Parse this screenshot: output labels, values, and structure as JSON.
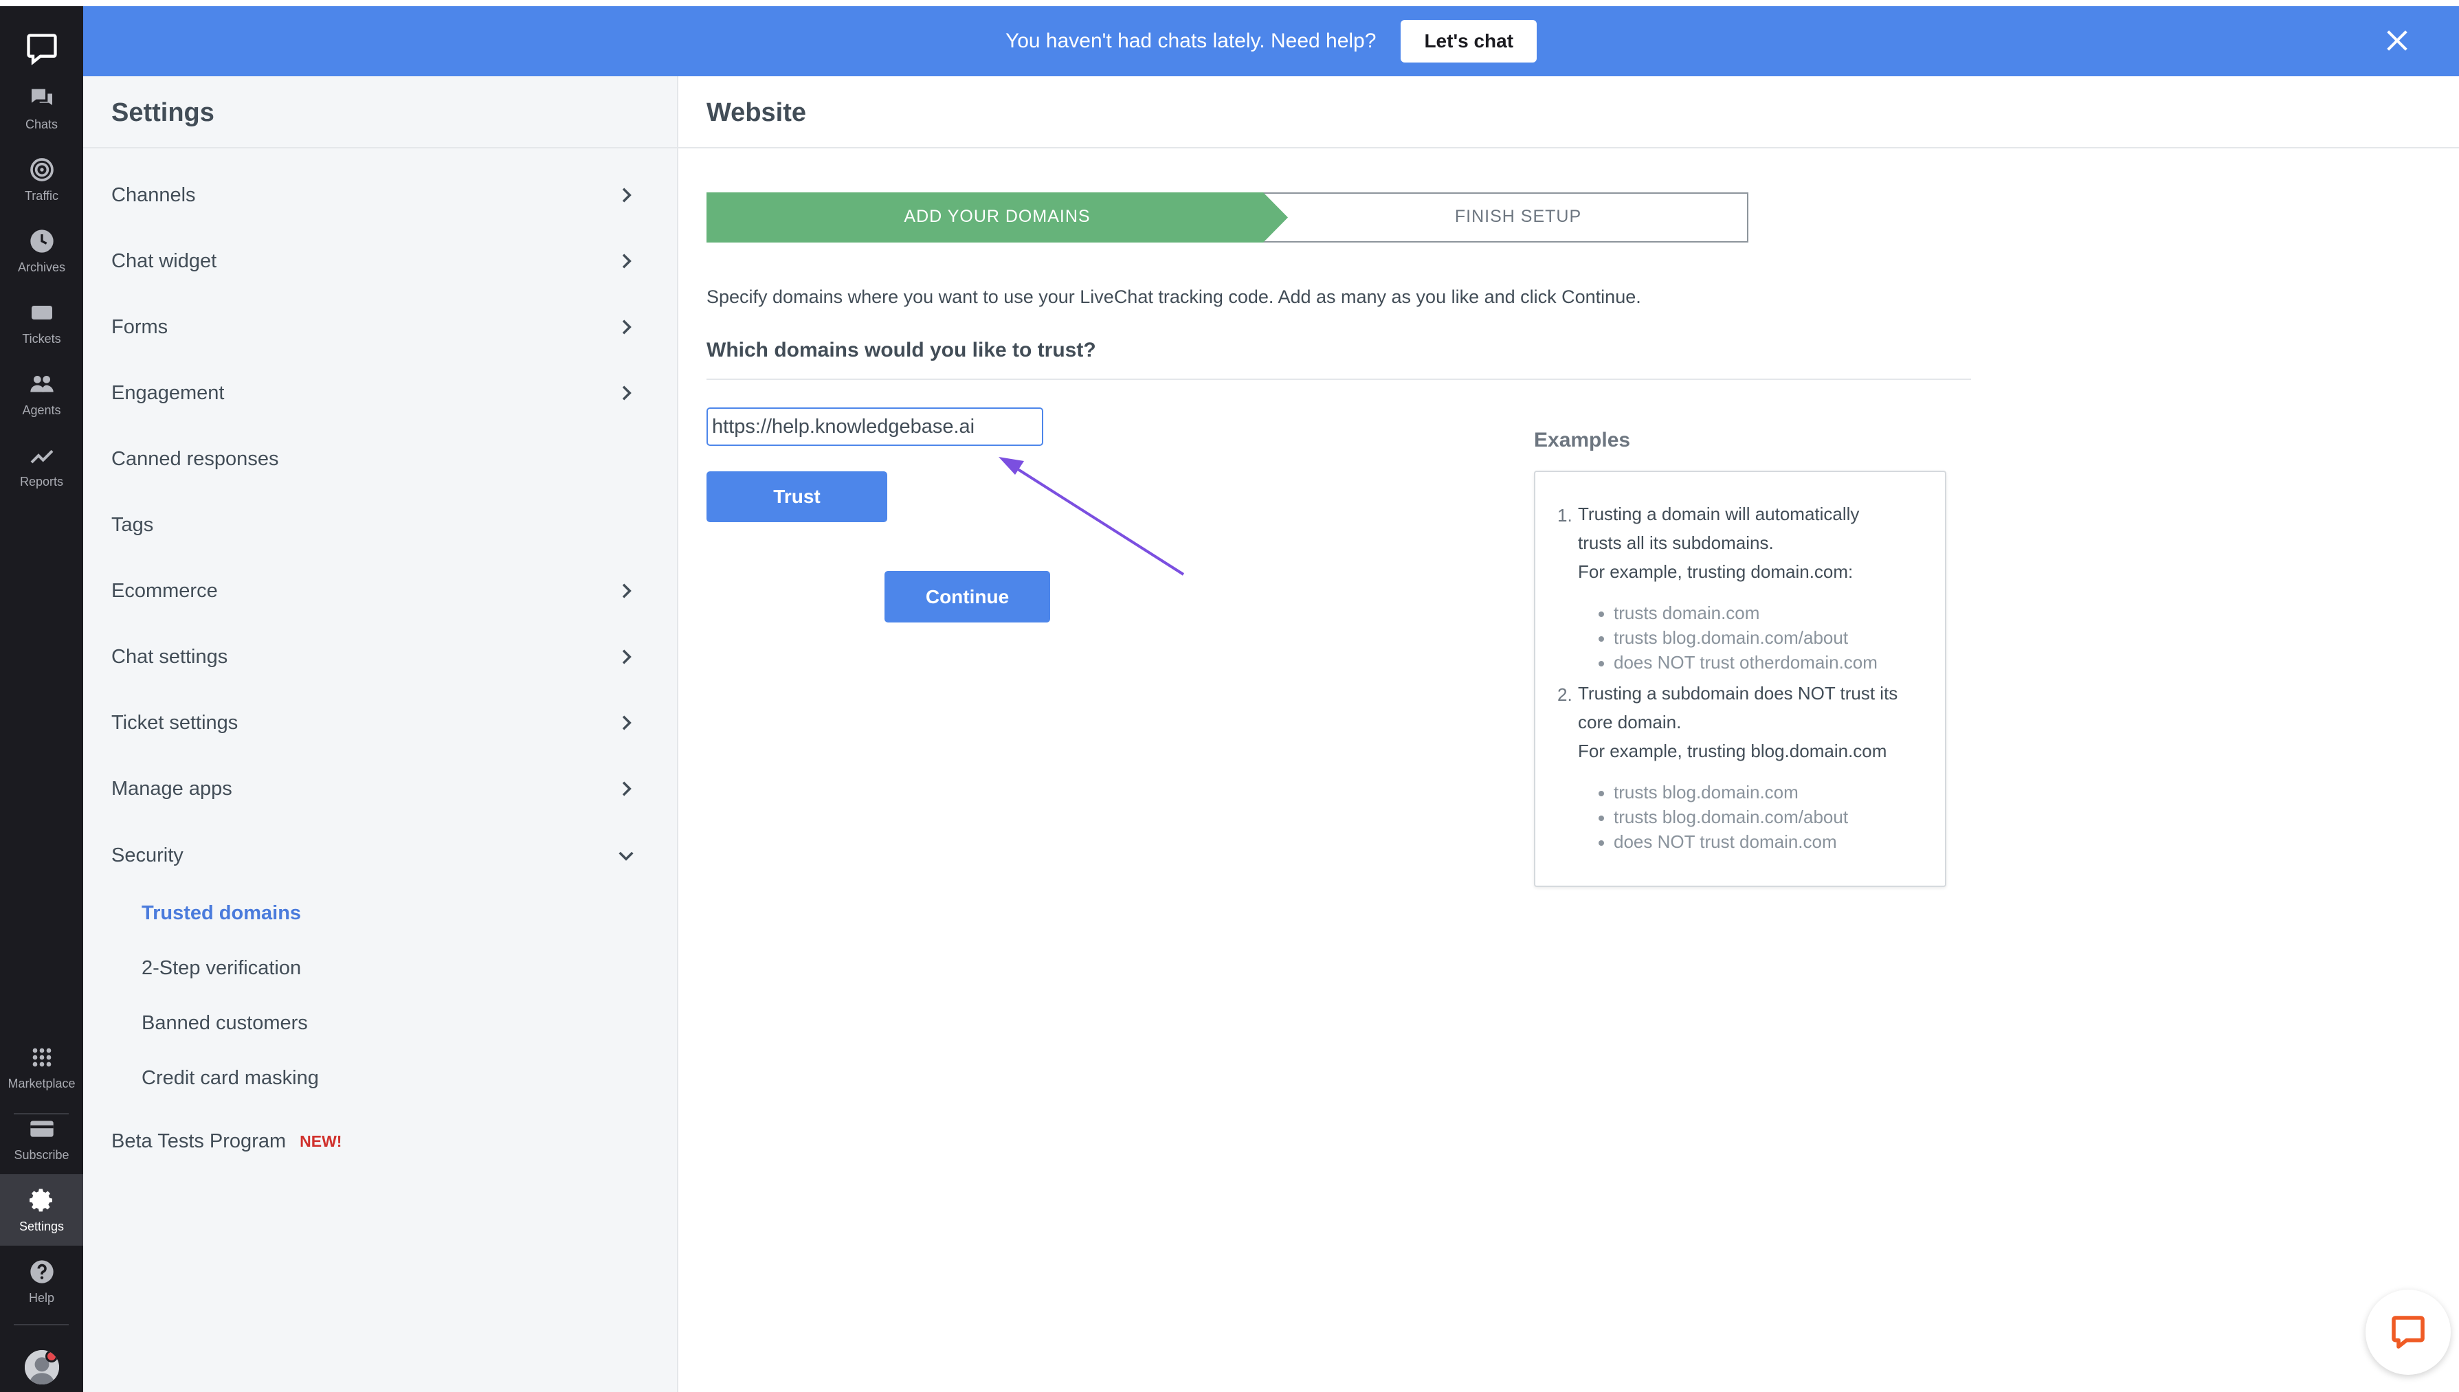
{
  "banner": {
    "text": "You haven't had chats lately. Need help?",
    "button_label": "Let's chat"
  },
  "rail": {
    "items": [
      {
        "label": "Chats",
        "icon": "chats-icon"
      },
      {
        "label": "Traffic",
        "icon": "traffic-icon"
      },
      {
        "label": "Archives",
        "icon": "archives-icon"
      },
      {
        "label": "Tickets",
        "icon": "tickets-icon"
      },
      {
        "label": "Agents",
        "icon": "agents-icon"
      },
      {
        "label": "Reports",
        "icon": "reports-icon"
      }
    ],
    "bottom_items": [
      {
        "label": "Marketplace",
        "icon": "marketplace-icon"
      },
      {
        "label": "Subscribe",
        "icon": "subscribe-icon"
      },
      {
        "label": "Settings",
        "icon": "settings-icon"
      },
      {
        "label": "Help",
        "icon": "help-icon"
      }
    ],
    "active": "Settings"
  },
  "settings": {
    "title": "Settings",
    "items": [
      {
        "label": "Channels"
      },
      {
        "label": "Chat widget"
      },
      {
        "label": "Forms"
      },
      {
        "label": "Engagement"
      },
      {
        "label": "Canned responses"
      },
      {
        "label": "Tags"
      },
      {
        "label": "Ecommerce"
      },
      {
        "label": "Chat settings"
      },
      {
        "label": "Ticket settings"
      },
      {
        "label": "Manage apps"
      },
      {
        "label": "Security"
      }
    ],
    "security_sub": [
      {
        "label": "Trusted domains"
      },
      {
        "label": "2-Step verification"
      },
      {
        "label": "Banned customers"
      },
      {
        "label": "Credit card masking"
      }
    ],
    "beta": {
      "label": "Beta Tests Program",
      "badge": "NEW!"
    }
  },
  "main": {
    "title": "Website",
    "steps": [
      {
        "label": "ADD YOUR DOMAINS",
        "state": "active"
      },
      {
        "label": "FINISH SETUP",
        "state": "pending"
      }
    ],
    "description": "Specify domains where you want to use your LiveChat tracking code. Add as many as you like and click Continue.",
    "question": "Which domains would you like to trust?",
    "domain_input_value": "https://help.knowledgebase.ai",
    "trust_label": "Trust",
    "continue_label": "Continue"
  },
  "examples": {
    "title": "Examples",
    "items": [
      {
        "number": "1.",
        "lines": [
          "Trusting a domain will automatically",
          "trusts all its subdomains."
        ],
        "example_intro": "For example, trusting domain.com:",
        "bullets": [
          "trusts domain.com",
          "trusts blog.domain.com/about",
          "does NOT trust otherdomain.com"
        ]
      },
      {
        "number": "2.",
        "lines": [
          "Trusting a subdomain does NOT trust its",
          "core domain."
        ],
        "example_intro": "For example, trusting blog.domain.com",
        "bullets": [
          "trusts blog.domain.com",
          "trusts blog.domain.com/about",
          "does NOT trust domain.com"
        ]
      }
    ]
  },
  "colors": {
    "banner": "#4d86ea",
    "rail": "#1b1b20",
    "step_active": "#66b37a",
    "primary_button": "#4d86ea",
    "active_link": "#4a7bdc",
    "new_badge": "#d0312d",
    "annotation_arrow": "#7b4fe0"
  }
}
